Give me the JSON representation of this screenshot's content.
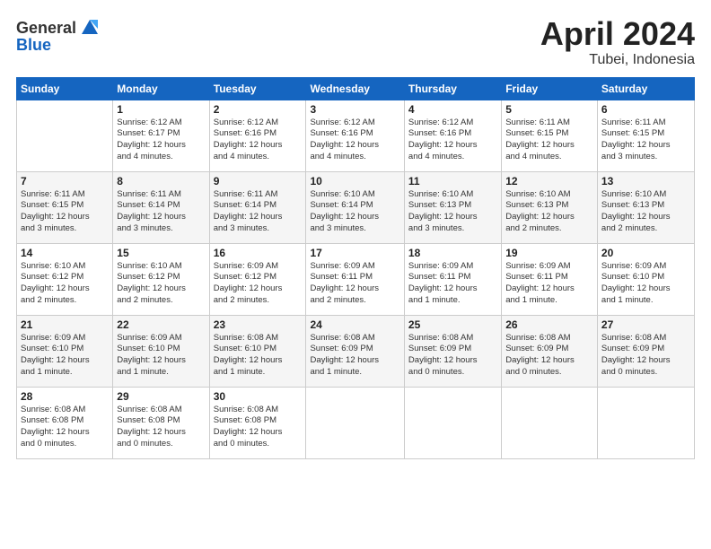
{
  "header": {
    "logo_general": "General",
    "logo_blue": "Blue",
    "title": "April 2024",
    "location": "Tubei, Indonesia"
  },
  "calendar": {
    "columns": [
      "Sunday",
      "Monday",
      "Tuesday",
      "Wednesday",
      "Thursday",
      "Friday",
      "Saturday"
    ],
    "weeks": [
      [
        {
          "day": "",
          "info": ""
        },
        {
          "day": "1",
          "info": "Sunrise: 6:12 AM\nSunset: 6:17 PM\nDaylight: 12 hours\nand 4 minutes."
        },
        {
          "day": "2",
          "info": "Sunrise: 6:12 AM\nSunset: 6:16 PM\nDaylight: 12 hours\nand 4 minutes."
        },
        {
          "day": "3",
          "info": "Sunrise: 6:12 AM\nSunset: 6:16 PM\nDaylight: 12 hours\nand 4 minutes."
        },
        {
          "day": "4",
          "info": "Sunrise: 6:12 AM\nSunset: 6:16 PM\nDaylight: 12 hours\nand 4 minutes."
        },
        {
          "day": "5",
          "info": "Sunrise: 6:11 AM\nSunset: 6:15 PM\nDaylight: 12 hours\nand 4 minutes."
        },
        {
          "day": "6",
          "info": "Sunrise: 6:11 AM\nSunset: 6:15 PM\nDaylight: 12 hours\nand 3 minutes."
        }
      ],
      [
        {
          "day": "7",
          "info": "Sunrise: 6:11 AM\nSunset: 6:15 PM\nDaylight: 12 hours\nand 3 minutes."
        },
        {
          "day": "8",
          "info": "Sunrise: 6:11 AM\nSunset: 6:14 PM\nDaylight: 12 hours\nand 3 minutes."
        },
        {
          "day": "9",
          "info": "Sunrise: 6:11 AM\nSunset: 6:14 PM\nDaylight: 12 hours\nand 3 minutes."
        },
        {
          "day": "10",
          "info": "Sunrise: 6:10 AM\nSunset: 6:14 PM\nDaylight: 12 hours\nand 3 minutes."
        },
        {
          "day": "11",
          "info": "Sunrise: 6:10 AM\nSunset: 6:13 PM\nDaylight: 12 hours\nand 3 minutes."
        },
        {
          "day": "12",
          "info": "Sunrise: 6:10 AM\nSunset: 6:13 PM\nDaylight: 12 hours\nand 2 minutes."
        },
        {
          "day": "13",
          "info": "Sunrise: 6:10 AM\nSunset: 6:13 PM\nDaylight: 12 hours\nand 2 minutes."
        }
      ],
      [
        {
          "day": "14",
          "info": "Sunrise: 6:10 AM\nSunset: 6:12 PM\nDaylight: 12 hours\nand 2 minutes."
        },
        {
          "day": "15",
          "info": "Sunrise: 6:10 AM\nSunset: 6:12 PM\nDaylight: 12 hours\nand 2 minutes."
        },
        {
          "day": "16",
          "info": "Sunrise: 6:09 AM\nSunset: 6:12 PM\nDaylight: 12 hours\nand 2 minutes."
        },
        {
          "day": "17",
          "info": "Sunrise: 6:09 AM\nSunset: 6:11 PM\nDaylight: 12 hours\nand 2 minutes."
        },
        {
          "day": "18",
          "info": "Sunrise: 6:09 AM\nSunset: 6:11 PM\nDaylight: 12 hours\nand 1 minute."
        },
        {
          "day": "19",
          "info": "Sunrise: 6:09 AM\nSunset: 6:11 PM\nDaylight: 12 hours\nand 1 minute."
        },
        {
          "day": "20",
          "info": "Sunrise: 6:09 AM\nSunset: 6:10 PM\nDaylight: 12 hours\nand 1 minute."
        }
      ],
      [
        {
          "day": "21",
          "info": "Sunrise: 6:09 AM\nSunset: 6:10 PM\nDaylight: 12 hours\nand 1 minute."
        },
        {
          "day": "22",
          "info": "Sunrise: 6:09 AM\nSunset: 6:10 PM\nDaylight: 12 hours\nand 1 minute."
        },
        {
          "day": "23",
          "info": "Sunrise: 6:08 AM\nSunset: 6:10 PM\nDaylight: 12 hours\nand 1 minute."
        },
        {
          "day": "24",
          "info": "Sunrise: 6:08 AM\nSunset: 6:09 PM\nDaylight: 12 hours\nand 1 minute."
        },
        {
          "day": "25",
          "info": "Sunrise: 6:08 AM\nSunset: 6:09 PM\nDaylight: 12 hours\nand 0 minutes."
        },
        {
          "day": "26",
          "info": "Sunrise: 6:08 AM\nSunset: 6:09 PM\nDaylight: 12 hours\nand 0 minutes."
        },
        {
          "day": "27",
          "info": "Sunrise: 6:08 AM\nSunset: 6:09 PM\nDaylight: 12 hours\nand 0 minutes."
        }
      ],
      [
        {
          "day": "28",
          "info": "Sunrise: 6:08 AM\nSunset: 6:08 PM\nDaylight: 12 hours\nand 0 minutes."
        },
        {
          "day": "29",
          "info": "Sunrise: 6:08 AM\nSunset: 6:08 PM\nDaylight: 12 hours\nand 0 minutes."
        },
        {
          "day": "30",
          "info": "Sunrise: 6:08 AM\nSunset: 6:08 PM\nDaylight: 12 hours\nand 0 minutes."
        },
        {
          "day": "",
          "info": ""
        },
        {
          "day": "",
          "info": ""
        },
        {
          "day": "",
          "info": ""
        },
        {
          "day": "",
          "info": ""
        }
      ]
    ]
  }
}
